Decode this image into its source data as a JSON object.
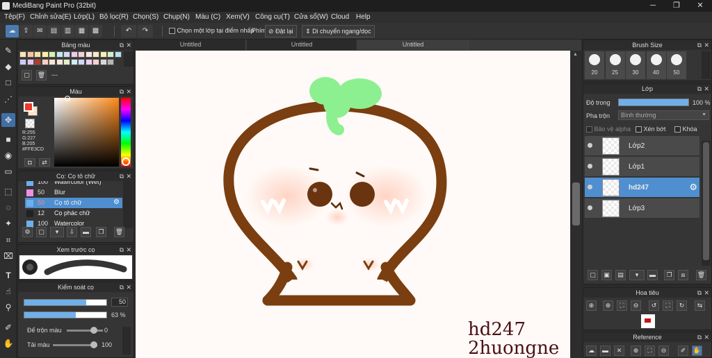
{
  "window": {
    "title": "MediBang Paint Pro (32bit)",
    "min": "─",
    "max": "❐",
    "close": "✕"
  },
  "menu": [
    "Tệp(F)",
    "Chỉnh sửa(E)",
    "Lớp(L)",
    "Bộ lọc(R)",
    "Chọn(S)",
    "Chụp(N)",
    "Màu (C)",
    "Xem(V)",
    "Công cụ(T)",
    "Cửa sổ(W)",
    "Cloud",
    "Help"
  ],
  "toolbar": {
    "select_layer_label": "Chọn một lớp tại điểm nhấp",
    "keys_label": "Phím",
    "reset_label": "Đặt lại",
    "move_label": "Di chuyển ngang/dọc"
  },
  "tabs": [
    "Untitled",
    "Untitled",
    "Untitled"
  ],
  "palette": {
    "title": "Bảng màu",
    "dashes": "---",
    "swatches": [
      "#fde6b4",
      "#f8c5a0",
      "#ffe2a2",
      "#fff1a8",
      "#d7f2b0",
      "#bfe8f2",
      "#d4d7f4",
      "#f2c8e8",
      "#f2d2d2",
      "#fbe7e7",
      "#ffe9c7",
      "#f5f0b0",
      "#d5eec8",
      "#b7e1ef",
      "#c8cef6",
      "#e5c6ef",
      "#b33a2e",
      "#f7d0c0",
      "#fde3d3",
      "#fbe6d6",
      "#e2f0c8",
      "#d0ecf5",
      "#d2d6f5",
      "#ebd0f0",
      "#f5d0d0",
      "#d8d8d8",
      "#b5b5b5"
    ]
  },
  "color": {
    "title": "Màu",
    "r": "R:255",
    "g": "G:227",
    "b": "B:205",
    "hex": "#FFE3CD",
    "fg": "#e83b2a",
    "bg": "#ffe3cd"
  },
  "brush_panel": {
    "title": "Cọ: Cọ tô chữ",
    "items": [
      {
        "size": "100",
        "name": "Watercolor (Wet)",
        "color": "#6fb0ea"
      },
      {
        "size": "50",
        "name": "Blur",
        "color": "#f08ee6"
      },
      {
        "size": "50",
        "name": "Cọ tô chữ",
        "color": "#6fb0ea",
        "selected": true
      },
      {
        "size": "12",
        "name": "Cọ phác chữ",
        "color": "#222222"
      },
      {
        "size": "100",
        "name": "Watercolor",
        "color": "#6fb0ea"
      }
    ]
  },
  "preview": {
    "title": "Xem trước cọ"
  },
  "brush_control": {
    "title": "Kiểm soát cọ",
    "size_value": "50",
    "size_pct": 0.75,
    "opacity_value": "63 %",
    "opacity_pct": 0.63,
    "mix_label": "Để trộn màu",
    "mix_value": "0",
    "load_label": "Tải màu",
    "load_value": "100"
  },
  "brush_size": {
    "title": "Brush Size",
    "sizes": [
      "20",
      "25",
      "30",
      "40",
      "50"
    ]
  },
  "layers": {
    "title": "Lớp",
    "opacity_label": "Độ trong",
    "opacity_value": "100 %",
    "blend_label": "Pha trộn",
    "blend_value": "Bình thường",
    "protect_alpha": "Bảo vệ alpha",
    "clipping": "Xén bớt",
    "lock": "Khóa",
    "rows": [
      {
        "name": "Lớp2",
        "selected": false
      },
      {
        "name": "Lớp1",
        "selected": false
      },
      {
        "name": "hd247",
        "selected": true
      },
      {
        "name": "Lớp3",
        "selected": false
      }
    ]
  },
  "navigator": {
    "title": "Hoa tiêu"
  },
  "reference": {
    "title": "Reference"
  },
  "canvas": {
    "watermark_line1": "hd247",
    "watermark_line2": "2huongne",
    "outline_color": "#7a3e10",
    "sprout_color": "#8df090",
    "blush_color": "#ffd6c8"
  }
}
